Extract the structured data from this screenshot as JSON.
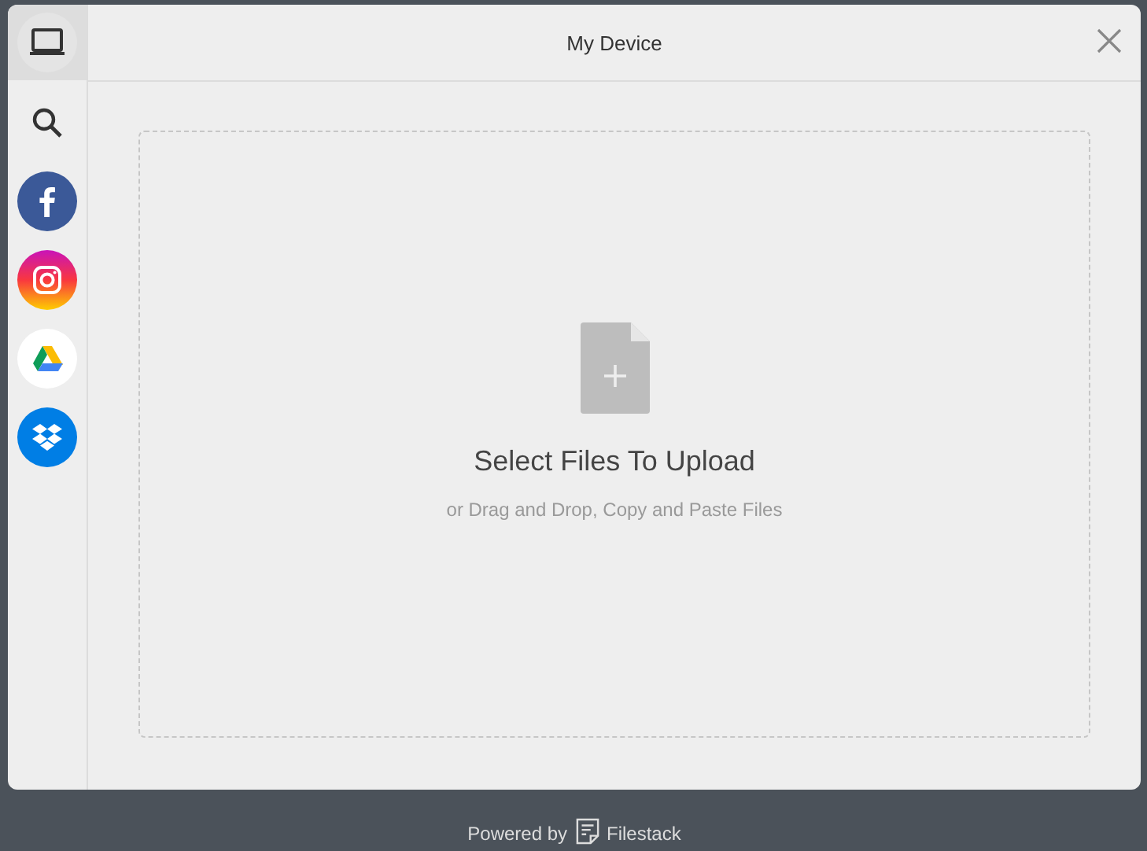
{
  "sources": [
    {
      "kind": "device",
      "selected": true
    },
    {
      "kind": "search",
      "selected": false
    },
    {
      "kind": "facebook",
      "selected": false
    },
    {
      "kind": "instagram",
      "selected": false
    },
    {
      "kind": "drive",
      "selected": false
    },
    {
      "kind": "dropbox",
      "selected": false
    }
  ],
  "header": {
    "title": "My Device"
  },
  "dropzone": {
    "title": "Select Files To Upload",
    "subtitle": "or Drag and Drop, Copy and Paste Files"
  },
  "footer": {
    "prefix": "Powered by",
    "brand": "Filestack"
  }
}
